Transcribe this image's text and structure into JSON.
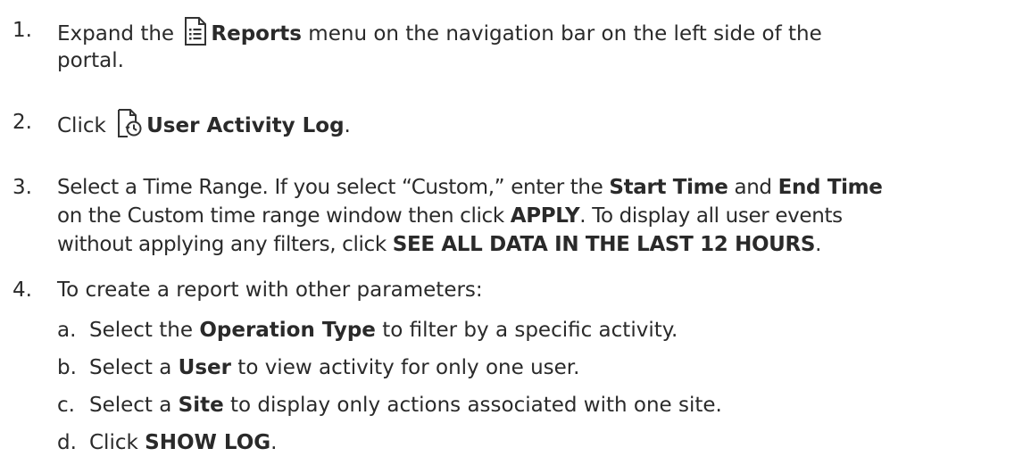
{
  "steps": [
    {
      "number": "1.",
      "pre": "Expand the ",
      "icon": "report-document-icon",
      "bold": "Reports",
      "post": " menu on the navigation bar on the left side of the",
      "line2": "portal."
    },
    {
      "number": "2.",
      "pre": "Click ",
      "icon": "user-activity-log-icon",
      "bold": "User Activity Log",
      "post": "."
    },
    {
      "number": "3.",
      "line1_pre": "Select a Time Range. If you select “Custom,” enter the ",
      "start_time": "Start Time",
      "and": " and ",
      "end_time": "End Time",
      "line2_pre": "on the Custom time range window then click ",
      "apply": "APPLY",
      "line2_post": ". To display all user events",
      "line3_pre": "without applying any filters, click ",
      "see_all": "SEE ALL DATA IN THE LAST 12 HOURS",
      "line3_post": "."
    },
    {
      "number": "4.",
      "text": "To create a report with other parameters:"
    }
  ],
  "substeps": [
    {
      "letter": "a.",
      "pre": "Select the ",
      "bold": "Operation Type",
      "post": " to filter by a specific activity."
    },
    {
      "letter": "b.",
      "pre": "Select a ",
      "bold": "User",
      "post": " to view activity for only one user."
    },
    {
      "letter": "c.",
      "pre": "Select a ",
      "bold": "Site",
      "post": " to display only actions associated with one site."
    },
    {
      "letter": "d.",
      "pre": "Click ",
      "bold": "SHOW LOG",
      "post": "."
    }
  ]
}
